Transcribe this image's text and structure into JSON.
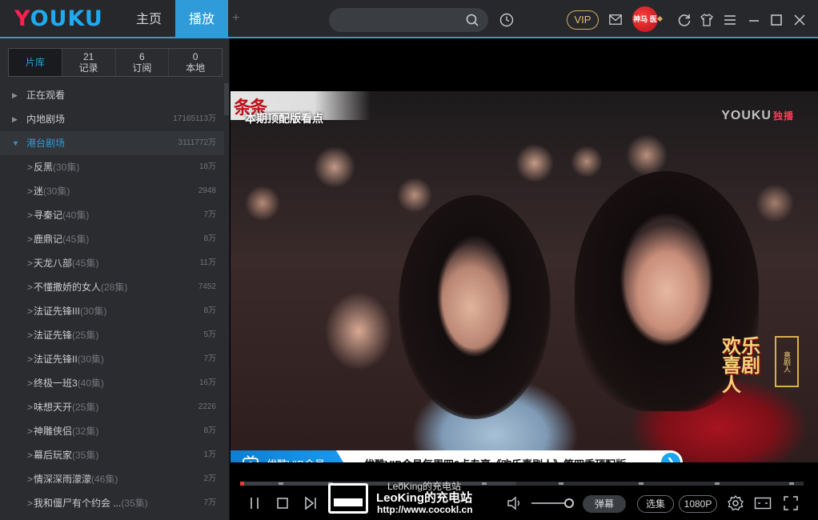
{
  "header": {
    "logo_first": "Y",
    "logo_rest": "OUKU",
    "tabs": [
      {
        "label": "主页"
      },
      {
        "label": "播放"
      }
    ],
    "plus": "+",
    "vip_label": "VIP",
    "avatar_text": "神马 医子"
  },
  "sidebar": {
    "segments": [
      {
        "num": "",
        "label": "片库"
      },
      {
        "num": "21",
        "label": "记录"
      },
      {
        "num": "6",
        "label": "订阅"
      },
      {
        "num": "0",
        "label": "本地"
      }
    ],
    "categories": [
      {
        "label": "正在观看",
        "count": ""
      },
      {
        "label": "内地剧场",
        "count": "17165113万"
      },
      {
        "label": "港台剧场",
        "count": "3111772万"
      }
    ],
    "shows": [
      {
        "title": "反黑",
        "eps": "(30集)",
        "views": "18万"
      },
      {
        "title": "迷",
        "eps": "(30集)",
        "views": "2948"
      },
      {
        "title": "寻秦记",
        "eps": "(40集)",
        "views": "7万"
      },
      {
        "title": "鹿鼎记",
        "eps": "(45集)",
        "views": "8万"
      },
      {
        "title": "天龙八部",
        "eps": "(45集)",
        "views": "11万"
      },
      {
        "title": "不懂撒娇的女人",
        "eps": "(28集)",
        "views": "7452"
      },
      {
        "title": "法证先锋III",
        "eps": "(30集)",
        "views": "8万"
      },
      {
        "title": "法证先锋",
        "eps": "(25集)",
        "views": "5万"
      },
      {
        "title": "法证先锋II",
        "eps": "(30集)",
        "views": "7万"
      },
      {
        "title": "终极一班3",
        "eps": "(40集)",
        "views": "16万"
      },
      {
        "title": "味想天开",
        "eps": "(25集)",
        "views": "2226"
      },
      {
        "title": "神雕侠侣",
        "eps": "(32集)",
        "views": "8万"
      },
      {
        "title": "幕后玩家",
        "eps": "(35集)",
        "views": "1万"
      },
      {
        "title": "情深深雨濛濛",
        "eps": "(46集)",
        "views": "2万"
      },
      {
        "title": "我和僵尸有个约会 ...",
        "eps": "(35集)",
        "views": "7万"
      }
    ]
  },
  "player": {
    "corner_text": "条条",
    "caption": "本期顶配版看点",
    "watermark": "YOUKU",
    "watermark_tag": "独播",
    "show_logo": "欢乐喜剧人",
    "trophy_text": "喜剧人",
    "banner_vip": "优酷VIP会员",
    "banner_text": "优酷VIP会员每周四0点专享《欢乐喜剧人》第四季顶配版",
    "progress_played": 0.007,
    "controls": {
      "danmu": "弹幕",
      "select_ep": "选集",
      "quality": "1080P"
    }
  },
  "overlay_watermark": {
    "line1": "LeoKing的充电站",
    "line2": "LeoKing的充电站",
    "line3": "http://www.cocokl.cn"
  }
}
